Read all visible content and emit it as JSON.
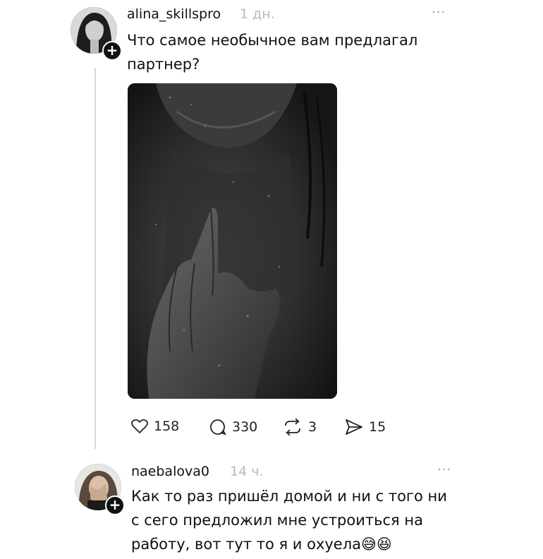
{
  "post": {
    "username": "alina_skillspro",
    "time": "1 дн.",
    "more": "...",
    "text_line1": "Что самое необычное вам предлагал",
    "text_line2": "партнер?",
    "stats": {
      "likes": "158",
      "comments": "330",
      "reposts": "3",
      "shares": "15"
    }
  },
  "reply": {
    "username": "naebalova0",
    "time": "14 ч.",
    "more": "...",
    "text_line1": "Как то раз пришёл домой и ни с того ни",
    "text_line2": "с сего предложил мне устроиться на",
    "text_line3": "работу, вот тут то я и охуела😅😆"
  },
  "icons": {
    "plus": "+"
  }
}
